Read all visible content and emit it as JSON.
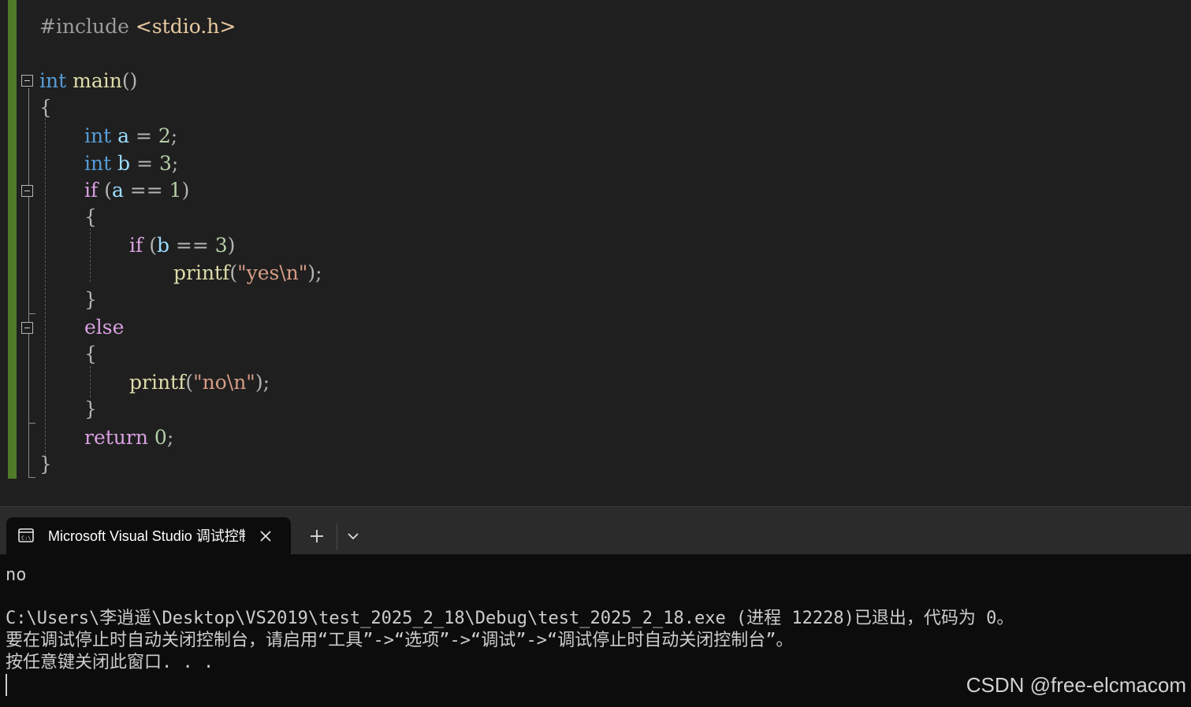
{
  "editor": {
    "lines": [
      {
        "tokens": [
          {
            "t": "#include ",
            "c": "pre"
          },
          {
            "t": "<stdio.h>",
            "c": "inc"
          }
        ]
      },
      {
        "tokens": []
      },
      {
        "tokens": [
          {
            "t": "int",
            "c": "kw"
          },
          {
            "t": " ",
            "c": "punc"
          },
          {
            "t": "main",
            "c": "fn"
          },
          {
            "t": "()",
            "c": "punc"
          }
        ]
      },
      {
        "tokens": [
          {
            "t": "{",
            "c": "punc"
          }
        ]
      },
      {
        "tokens": [
          {
            "t": "int",
            "c": "kw"
          },
          {
            "t": " ",
            "c": "punc"
          },
          {
            "t": "a",
            "c": "var"
          },
          {
            "t": " = ",
            "c": "punc"
          },
          {
            "t": "2",
            "c": "num"
          },
          {
            "t": ";",
            "c": "punc"
          }
        ]
      },
      {
        "tokens": [
          {
            "t": "int",
            "c": "kw"
          },
          {
            "t": " ",
            "c": "punc"
          },
          {
            "t": "b",
            "c": "var"
          },
          {
            "t": " = ",
            "c": "punc"
          },
          {
            "t": "3",
            "c": "num"
          },
          {
            "t": ";",
            "c": "punc"
          }
        ]
      },
      {
        "tokens": [
          {
            "t": "if",
            "c": "ctl"
          },
          {
            "t": " (",
            "c": "punc"
          },
          {
            "t": "a",
            "c": "var"
          },
          {
            "t": " == ",
            "c": "punc"
          },
          {
            "t": "1",
            "c": "num"
          },
          {
            "t": ")",
            "c": "punc"
          }
        ]
      },
      {
        "tokens": [
          {
            "t": "{",
            "c": "punc"
          }
        ]
      },
      {
        "tokens": [
          {
            "t": "if",
            "c": "ctl"
          },
          {
            "t": " (",
            "c": "punc"
          },
          {
            "t": "b",
            "c": "var"
          },
          {
            "t": " == ",
            "c": "punc"
          },
          {
            "t": "3",
            "c": "num"
          },
          {
            "t": ")",
            "c": "punc"
          }
        ]
      },
      {
        "tokens": [
          {
            "t": "printf",
            "c": "fn"
          },
          {
            "t": "(",
            "c": "punc"
          },
          {
            "t": "\"yes\\n\"",
            "c": "str"
          },
          {
            "t": ");",
            "c": "punc"
          }
        ]
      },
      {
        "tokens": [
          {
            "t": "}",
            "c": "punc"
          }
        ]
      },
      {
        "tokens": [
          {
            "t": "else",
            "c": "ctl"
          }
        ]
      },
      {
        "tokens": [
          {
            "t": "{",
            "c": "punc"
          }
        ]
      },
      {
        "tokens": [
          {
            "t": "printf",
            "c": "fn"
          },
          {
            "t": "(",
            "c": "punc"
          },
          {
            "t": "\"no\\n\"",
            "c": "str"
          },
          {
            "t": ");",
            "c": "punc"
          }
        ]
      },
      {
        "tokens": [
          {
            "t": "}",
            "c": "punc"
          }
        ]
      },
      {
        "tokens": [
          {
            "t": "return",
            "c": "ctl"
          },
          {
            "t": " ",
            "c": "punc"
          },
          {
            "t": "0",
            "c": "num"
          },
          {
            "t": ";",
            "c": "punc"
          }
        ]
      },
      {
        "tokens": [
          {
            "t": "}",
            "c": "punc"
          }
        ]
      }
    ]
  },
  "terminal": {
    "tab_title": "Microsoft Visual Studio 调试控制台",
    "icon": "console-icon",
    "close_icon": "close-icon",
    "new_tab_icon": "plus-icon",
    "dropdown_icon": "chevron-down-icon"
  },
  "console": {
    "lines": [
      "no",
      "",
      "C:\\Users\\李逍遥\\Desktop\\VS2019\\test_2025_2_18\\Debug\\test_2025_2_18.exe (进程 12228)已退出，代码为 0。",
      "要在调试停止时自动关闭控制台，请启用“工具”->“选项”->“调试”->“调试停止时自动关闭控制台”。",
      "按任意键关闭此窗口. . ."
    ]
  },
  "watermark": "CSDN @free-elcmacom",
  "colors": {
    "editor_bg": "#1f1f1f",
    "change_bar": "#4f7a28",
    "keyword": "#569cd6",
    "control": "#d8a0df",
    "function": "#dcdcaa",
    "variable": "#9cdcfe",
    "number": "#b5cea8",
    "string": "#d69d85",
    "console_bg": "#0c0c0c",
    "console_text": "#cccccc"
  }
}
